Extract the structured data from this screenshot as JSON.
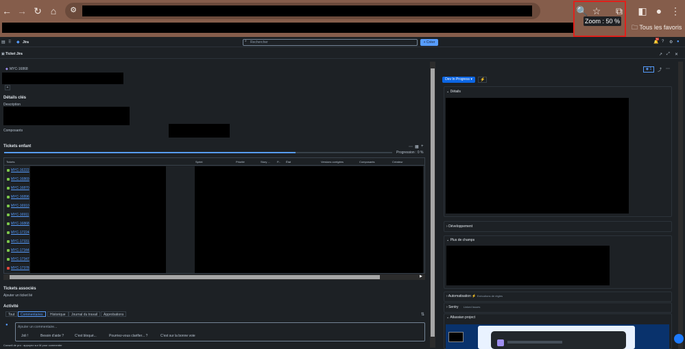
{
  "browser": {
    "back": "←",
    "forward": "→",
    "reload": "↻",
    "home": "⌂",
    "zoom_tooltip": "Zoom : 50 %",
    "bookmarks_all": "Tous les favoris"
  },
  "jira": {
    "app_name": "Jira",
    "search_placeholder": "Rechercher",
    "create_label": "+ Créer",
    "notif_count": "9+"
  },
  "ticket_bar": {
    "title": "Ticket Jira"
  },
  "issue": {
    "key": "MYC-16868",
    "add": "+",
    "key_details": "Détails clés",
    "description_label": "Description",
    "components_label": "Composants",
    "child_title": "Tickets enfant",
    "progress_label": "Progression : 0 %",
    "progress_fraction": 0.75,
    "columns": [
      "Tickets",
      "Sprint",
      "Priorité",
      "Story ...",
      "P...",
      "État",
      "Versions corrigées",
      "Composants",
      "Créateur"
    ],
    "rows": [
      "MYC-16222",
      "MYC-16869",
      "MYC-16870",
      "MYC-16896",
      "MYC-16910",
      "MYC-16911",
      "MYC-16868",
      "MYC-17224",
      "MYC-17331",
      "MYC-17344",
      "MYC-17347",
      "MYC-17378"
    ],
    "linked_title": "Tickets associés",
    "linked_add": "Ajouter un ticket lié",
    "activity_title": "Activité",
    "tabs": [
      "Tout",
      "Commentaires",
      "Historique",
      "Journal du travail",
      "Approbations"
    ],
    "comment_placeholder": "Ajouter un commentaire...",
    "chips": [
      "Joli !",
      "Besoin d'aide ?",
      "C'est bloqué...",
      "Pourriez-vous clarifier... ?",
      "C'est sur la bonne voie"
    ],
    "tip": "Conseil de pro : appuyez sur M pour commenter"
  },
  "right": {
    "watch_count": "1",
    "status": "Dev In Progress",
    "details": "Détails",
    "development": "Développement",
    "more_fields": "Plus de champs",
    "automation": "Automatisation",
    "automation_sub": "Exécutions de règles",
    "sentry": "Sentry",
    "sentry_sub": "Linked Issues",
    "atlassian": "Atlassian project"
  }
}
